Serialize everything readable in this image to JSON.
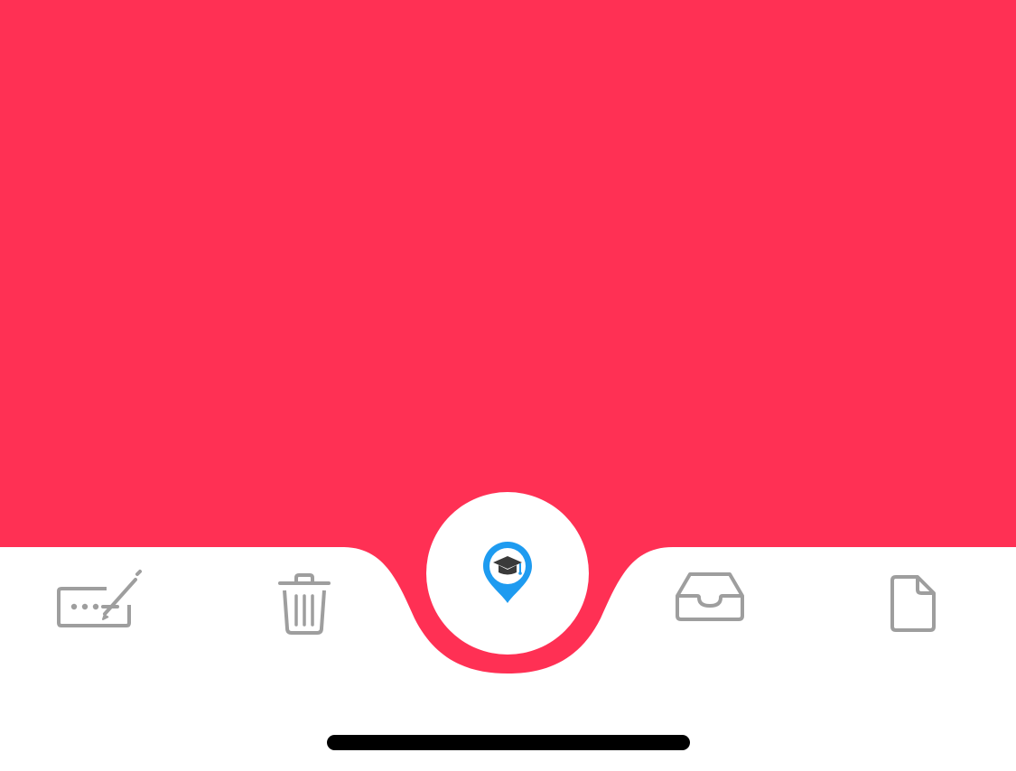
{
  "colors": {
    "accent": "#FF3054",
    "background": "#FFFFFF",
    "tab_icon": "#9E9E9E",
    "pin": "#1E9BF0",
    "cap": "#3A3A3A",
    "home_indicator": "#000000"
  },
  "tabbar": {
    "tabs": [
      {
        "icon": "signature-pencil-icon",
        "selected": false
      },
      {
        "icon": "trash-icon",
        "selected": false
      },
      {
        "icon": "location-pin-graduation-cap-icon",
        "selected": true
      },
      {
        "icon": "inbox-tray-icon",
        "selected": false
      },
      {
        "icon": "document-icon",
        "selected": false
      }
    ]
  }
}
